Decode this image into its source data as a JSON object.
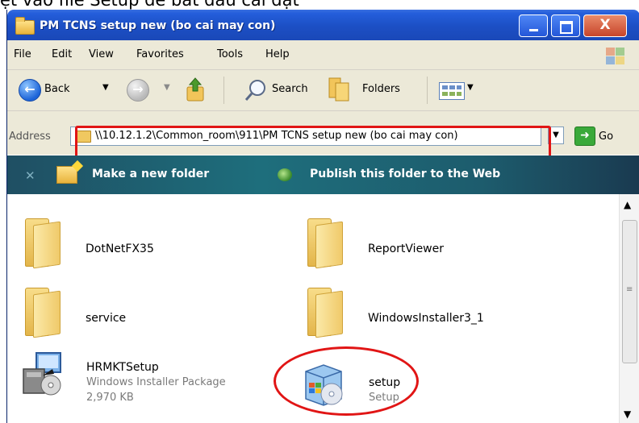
{
  "caption": "ệt vào file Setup để bắt đầu cài đặt",
  "window": {
    "title": "PM TCNS setup new (bo cai may con)",
    "close_glyph": "X"
  },
  "menu": [
    "File",
    "Edit",
    "View",
    "Favorites",
    "Tools",
    "Help"
  ],
  "toolbar": {
    "back_label": "Back",
    "search_label": "Search",
    "folders_label": "Folders"
  },
  "address": {
    "label": "Address",
    "path": "\\\\10.12.1.2\\Common_room\\911\\PM TCNS setup new (bo cai may con)",
    "go_label": "Go"
  },
  "tasks": {
    "new_folder": "Make a new folder",
    "publish": "Publish this folder to the Web"
  },
  "files": [
    {
      "name": "DotNetFX35",
      "type": "folder"
    },
    {
      "name": "ReportViewer",
      "type": "folder"
    },
    {
      "name": "service",
      "type": "folder"
    },
    {
      "name": "WindowsInstaller3_1",
      "type": "folder"
    },
    {
      "name": "HRMKTSetup",
      "type": "Windows Installer Package",
      "size": "2,970 KB"
    },
    {
      "name": "setup",
      "type": "Setup"
    }
  ],
  "colors": {
    "highlight": "#e11515",
    "titlebar": "#1c4fc4",
    "taskbar": "#1e6e7c"
  }
}
